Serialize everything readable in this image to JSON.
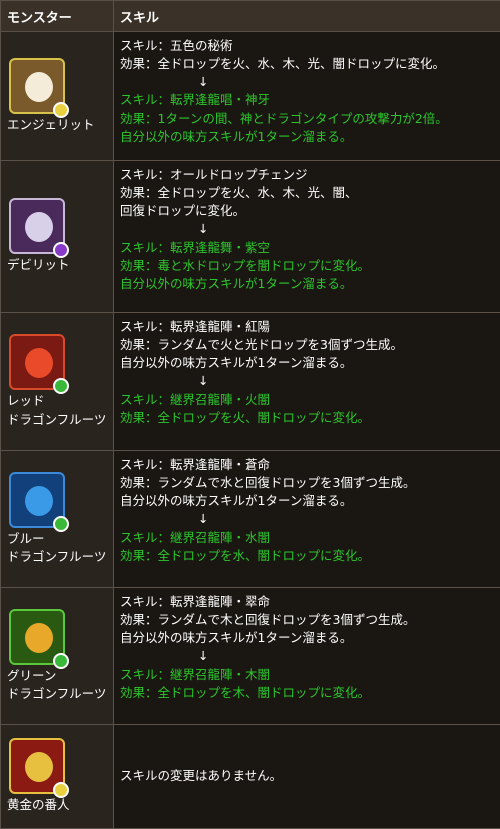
{
  "header": {
    "monster": "モンスター",
    "skill": "スキル"
  },
  "rows": [
    {
      "name": [
        "エンジェリット"
      ],
      "icon": "angel-icon",
      "white": [
        "スキル：五色の秘術",
        "効果：全ドロップを火、水、木、光、闇ドロップに変化。"
      ],
      "arrow": "↓",
      "green": [
        "スキル：転界逢龍唱・神牙",
        "効果：1ターンの間、神とドラゴンタイプの攻撃力が2倍。",
        "自分以外の味方スキルが1ターン溜まる。"
      ]
    },
    {
      "name": [
        "デビリット"
      ],
      "icon": "devil-icon",
      "white": [
        "スキル：オールドロップチェンジ",
        "効果：全ドロップを火、水、木、光、闇、",
        "回復ドロップに変化。"
      ],
      "arrow": "↓",
      "green": [
        "スキル：転界逢龍舞・紫空",
        "効果：毒と水ドロップを闇ドロップに変化。",
        "自分以外の味方スキルが1ターン溜まる。"
      ]
    },
    {
      "name": [
        "レッド",
        "ドラゴンフルーツ"
      ],
      "icon": "red-dragonfruit-icon",
      "white": [
        "スキル：転界逢龍陣・紅陽",
        "効果：ランダムで火と光ドロップを3個ずつ生成。",
        "自分以外の味方スキルが1ターン溜まる。"
      ],
      "arrow": "↓",
      "green": [
        "スキル：継界召龍陣・火闇",
        "効果：全ドロップを火、闇ドロップに変化。"
      ]
    },
    {
      "name": [
        "ブルー",
        "ドラゴンフルーツ"
      ],
      "icon": "blue-dragonfruit-icon",
      "white": [
        "スキル：転界逢龍陣・蒼命",
        "効果：ランダムで水と回復ドロップを3個ずつ生成。",
        "自分以外の味方スキルが1ターン溜まる。"
      ],
      "arrow": "↓",
      "green": [
        "スキル：継界召龍陣・水闇",
        "効果：全ドロップを水、闇ドロップに変化。"
      ]
    },
    {
      "name": [
        "グリーン",
        "ドラゴンフルーツ"
      ],
      "icon": "green-dragonfruit-icon",
      "white": [
        "スキル：転界逢龍陣・翠命",
        "効果：ランダムで木と回復ドロップを3個ずつ生成。",
        "自分以外の味方スキルが1ターン溜まる。"
      ],
      "arrow": "↓",
      "green": [
        "スキル：継界召龍陣・木闇",
        "効果：全ドロップを木、闇ドロップに変化。"
      ]
    },
    {
      "name": [
        "黄金の番人"
      ],
      "icon": "golden-guardian-icon",
      "white": [
        "スキルの変更はありません。"
      ]
    }
  ],
  "colors": {
    "green_text": "#2cc62c",
    "header_bg": "#3a3128",
    "border": "#5a5148"
  }
}
